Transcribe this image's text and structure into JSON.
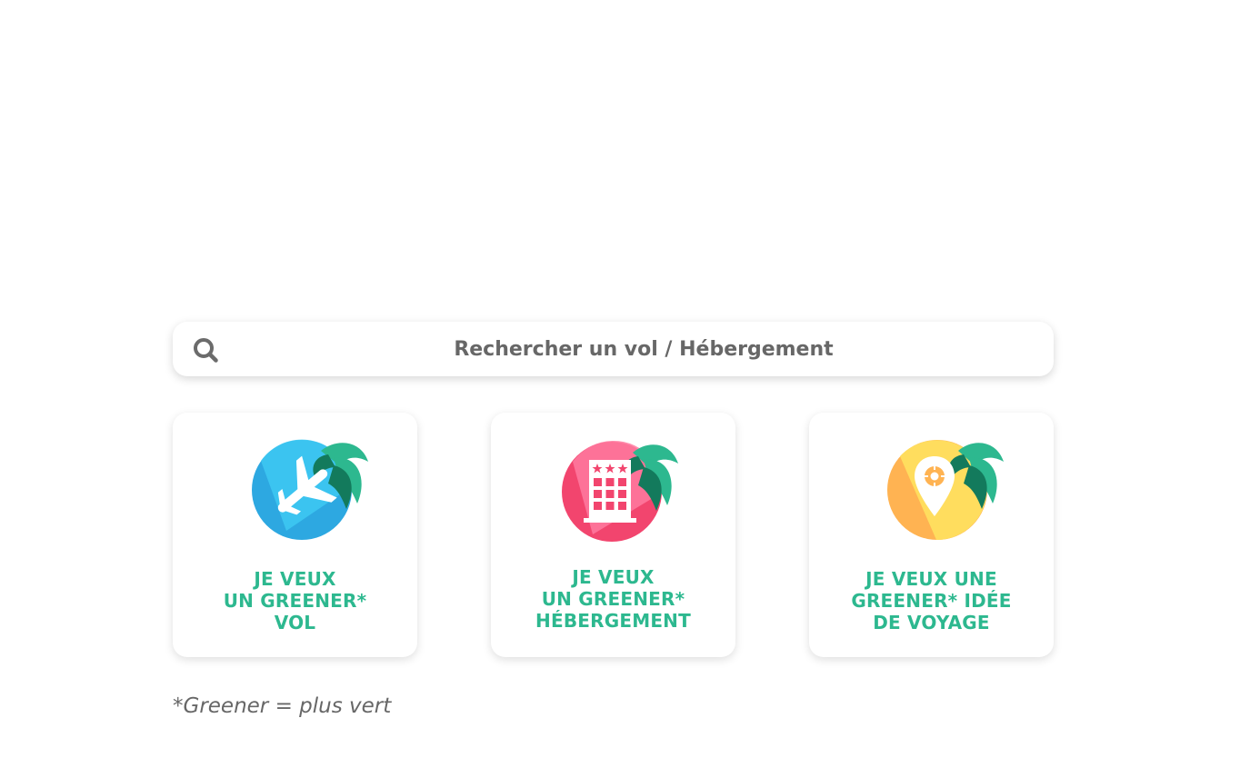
{
  "search": {
    "placeholder": "Rechercher un vol / Hébergement",
    "icon": "search-icon"
  },
  "cards": [
    {
      "icon": "plane-palm-icon",
      "lines": [
        "JE VEUX",
        "UN GREENER*",
        "VOL"
      ],
      "colors": {
        "circle": "#2da8e1",
        "light": "#3ec9f2",
        "leaf": "#2db88f",
        "leaf_dark": "#137a5c"
      }
    },
    {
      "icon": "hotel-palm-icon",
      "lines": [
        "JE VEUX",
        "UN GREENER*",
        "HÉBERGEMENT"
      ],
      "colors": {
        "circle": "#f2456e",
        "light": "#ff7aa0",
        "leaf": "#2db88f",
        "leaf_dark": "#137a5c"
      }
    },
    {
      "icon": "map-pin-palm-icon",
      "lines": [
        "JE VEUX UNE",
        "GREENER* IDÉE",
        "DE VOYAGE"
      ],
      "colors": {
        "circle": "#ffb352",
        "light": "#ffdd5e",
        "leaf": "#2db88f",
        "leaf_dark": "#137a5c"
      }
    }
  ],
  "footnote": "*Greener = plus vert",
  "colors": {
    "accent": "#2db88f",
    "text_gray": "#676767"
  }
}
